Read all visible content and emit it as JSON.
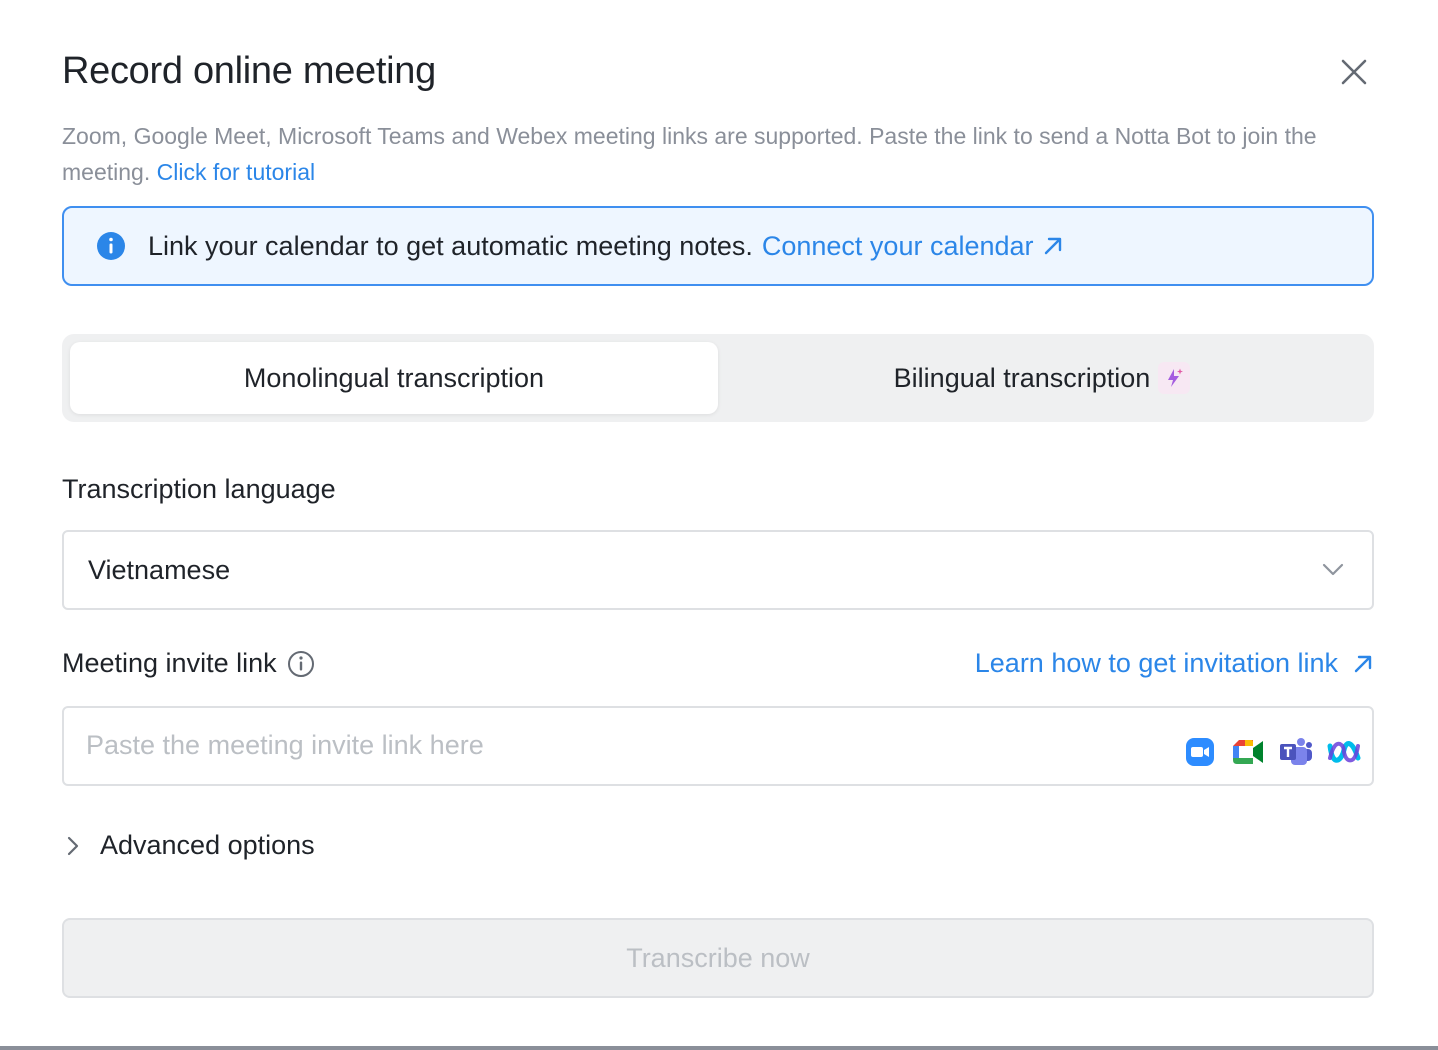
{
  "dialog": {
    "title": "Record online meeting",
    "description": "Zoom, Google Meet, Microsoft Teams and Webex meeting links are supported. Paste the link to send a Notta Bot to join the meeting.",
    "tutorial_link": "Click for tutorial"
  },
  "banner": {
    "text": "Link your calendar to get automatic meeting notes.",
    "link": "Connect your calendar"
  },
  "tabs": [
    {
      "label": "Monolingual transcription",
      "active": true
    },
    {
      "label": "Bilingual transcription",
      "active": false
    }
  ],
  "language": {
    "label": "Transcription language",
    "value": "Vietnamese"
  },
  "invite": {
    "label": "Meeting invite link",
    "help_link": "Learn how to get invitation link",
    "placeholder": "Paste the meeting invite link here",
    "value": "",
    "platforms": [
      "zoom-icon",
      "google-meet-icon",
      "microsoft-teams-icon",
      "webex-icon"
    ]
  },
  "advanced": {
    "label": "Advanced options"
  },
  "submit": {
    "label": "Transcribe now",
    "disabled": true
  },
  "colors": {
    "accent": "#2b86e8",
    "banner_bg": "#eef6ff",
    "banner_border": "#3f8ff0",
    "muted_text": "#8a8f99",
    "disabled_text": "#bbbfc4"
  }
}
